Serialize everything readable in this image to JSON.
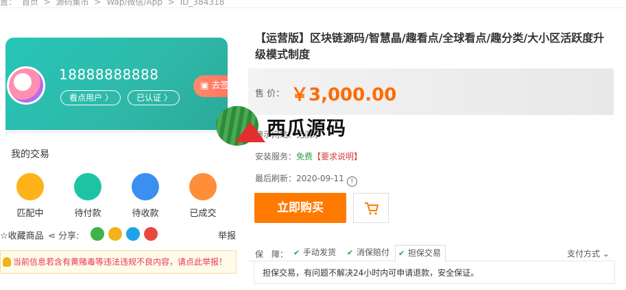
{
  "breadcrumb": {
    "items": [
      "置：",
      "首页",
      ">",
      "源码集市",
      ">",
      "Wap/微信/App",
      ">",
      "ID_384318"
    ]
  },
  "preview": {
    "phone_number": "18888888888",
    "badge_1": "看点用户 〉",
    "badge_2": "已认证 〉",
    "sign_button": "去签",
    "section_title": "我的交易",
    "trades": [
      "匹配中",
      "待付款",
      "待收款",
      "已成交"
    ]
  },
  "share": {
    "favorite": "收藏商品",
    "label": "分享:",
    "report": "举报"
  },
  "notice": {
    "text": "当前信息若含有黄赌毒等违法违规不良内容，请点此举报！"
  },
  "product": {
    "title": "【运营版】区块链源码/智慧晶/趣看点/全球看点/趣分类/大小区活跃度升级模式制度",
    "price_label": "售 价：",
    "price": "￥3,000.00",
    "demo_label": "演示网站：",
    "demo_value": "无演示",
    "install_label": "安装服务：",
    "install_free": "免费",
    "install_req": "【要求说明】",
    "refresh_label": "最后刷新：",
    "refresh_date": "2020-09-11"
  },
  "watermark": {
    "text": "西瓜源码"
  },
  "actions": {
    "buy": "立即购买"
  },
  "guarantee": {
    "label": "保　障：",
    "items": [
      "手动发货",
      "消保赔付",
      "担保交易"
    ],
    "pay_method": "支付方式",
    "description": "担保交易，有问题不解决24小时内可申请退款，安全保证。"
  },
  "colors": {
    "accent": "#ff7a00",
    "price": "#ff6a00",
    "free": "#2e9f3e",
    "teal": "#26c6b8"
  }
}
